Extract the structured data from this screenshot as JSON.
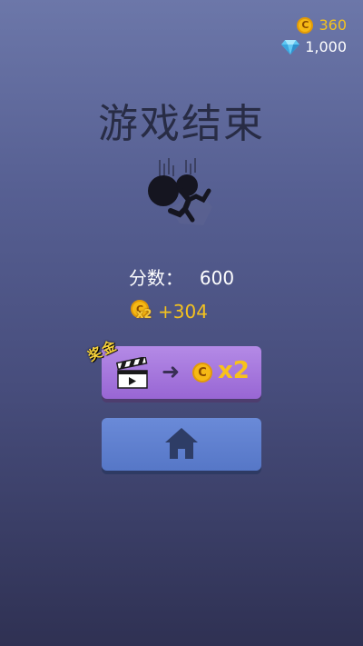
{
  "currency": {
    "gold_icon": "coin-icon",
    "gold_symbol": "C",
    "gold": "360",
    "gems_icon": "diamond-icon",
    "gems": "1,000"
  },
  "title": "游戏结束",
  "score": {
    "label": "分数：",
    "value": "600"
  },
  "reward": {
    "coin_symbol": "C",
    "multiplier": "x2",
    "amount": "+304"
  },
  "ad_button": {
    "tag": "奖金",
    "icon": "clapperboard-icon",
    "arrow": "➜",
    "coin_symbol": "C",
    "multiplier": "x2"
  },
  "home_button": {
    "icon": "home-icon"
  },
  "colors": {
    "gold": "#f4c21e",
    "ad_button": "#a979e0",
    "home_button": "#5f80cf",
    "title": "#282c45"
  }
}
